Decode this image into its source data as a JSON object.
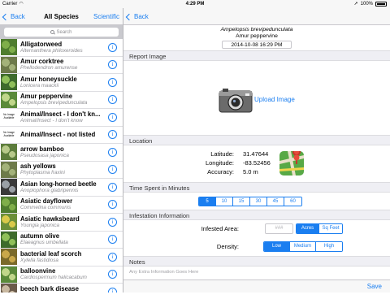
{
  "status": {
    "carrier": "Carrier",
    "time": "4:29 PM",
    "battery": "100%"
  },
  "left": {
    "back_label": "Back",
    "title": "All Species",
    "right_label": "Scientific",
    "search_placeholder": "Search",
    "rows": [
      {
        "name": "Alligatorweed",
        "sci": "Alternanthera philoxeroides",
        "thumb": "green-plant"
      },
      {
        "name": "Amur corktree",
        "sci": "Phellodendron amurense",
        "thumb": "tree"
      },
      {
        "name": "Amur honeysuckle",
        "sci": "Lonicera maackii",
        "thumb": "shrub"
      },
      {
        "name": "Amur peppervine",
        "sci": "Ampelopsis brevipedunculata",
        "thumb": "vine"
      },
      {
        "name": "Animal/Insect - I don't kn...",
        "sci": "Animal/Insect - I don't know",
        "thumb": "none"
      },
      {
        "name": "Animal/Insect - not listed",
        "sci": "",
        "thumb": "none"
      },
      {
        "name": "arrow bamboo",
        "sci": "Pseudosasa japonica",
        "thumb": "bamboo"
      },
      {
        "name": "ash yellows",
        "sci": "Phytoplasma fraxini",
        "thumb": "tree"
      },
      {
        "name": "Asian long-horned beetle",
        "sci": "Anoplophora glabripennis",
        "thumb": "beetle"
      },
      {
        "name": "Asiatic dayflower",
        "sci": "Commelina communis",
        "thumb": "green-plant"
      },
      {
        "name": "Asiatic hawksbeard",
        "sci": "Youngia japonica",
        "thumb": "weed"
      },
      {
        "name": "autumn olive",
        "sci": "Elaeagnus umbellata",
        "thumb": "shrub"
      },
      {
        "name": "bacterial leaf scorch",
        "sci": "Xylella fastidiosa",
        "thumb": "leaf"
      },
      {
        "name": "balloonvine",
        "sci": "Cardiospermum halicacabum",
        "thumb": "vine"
      },
      {
        "name": "beech bark disease",
        "sci": "Nectria coccinea",
        "thumb": "bark"
      }
    ],
    "no_image_text": "No Image Available"
  },
  "right": {
    "back_label": "Back",
    "species_sci": "Ampelopsis brevipedunculata",
    "species_common": "Amur peppervine",
    "date": "2014-10-08 16:29 PM",
    "report_image_header": "Report Image",
    "upload_label": "Upload Image",
    "location_header": "Location",
    "latitude_label": "Latitude:",
    "latitude_value": "31.47644",
    "longitude_label": "Longitude:",
    "longitude_value": "-83.52456",
    "accuracy_label": "Accuracy:",
    "accuracy_value": "5.0 m",
    "time_header": "Time Spent in Minutes",
    "time_options": [
      "5",
      "10",
      "15",
      "30",
      "45",
      "60"
    ],
    "time_selected": 0,
    "infestation_header": "Infestation Information",
    "infested_area_label": "Infested Area:",
    "area_placeholder": "###",
    "unit_options": [
      "Acres",
      "Sq Feet"
    ],
    "unit_selected": 0,
    "density_label": "Density:",
    "density_options": [
      "Low",
      "Medium",
      "High"
    ],
    "density_selected": 0,
    "notes_header": "Notes",
    "notes_placeholder": "Any Extra Information Goes Here",
    "save_label": "Save"
  },
  "colors": {
    "accent": "#1a7ef0",
    "section_bg": "#efeff4"
  }
}
